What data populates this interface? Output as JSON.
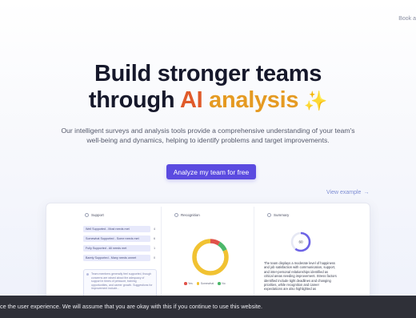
{
  "nav": {
    "link_label": "Book a"
  },
  "hero": {
    "title_line1": "Build stronger teams",
    "title_line2_prefix": "through ",
    "title_ai": "AI",
    "title_analysis": " analysis",
    "title_sparkle": " ✨"
  },
  "subtitle": "Our intelligent surveys and analysis tools provide a comprehensive understanding of your team's well-being and dynamics, helping to identify problems and target improvements.",
  "cta_label": "Analyze my team for free",
  "view_example": {
    "label": "View example",
    "arrow": "→"
  },
  "preview": {
    "support": {
      "title": "Support",
      "rows": [
        {
          "label": "Well Supported - Most needs met",
          "count": "4"
        },
        {
          "label": "Somewhat Supported - Some needs met",
          "count": "6"
        },
        {
          "label": "Fully Supported - All needs met",
          "count": "1"
        },
        {
          "label": "Barely Supported - Many needs unmet",
          "count": "0"
        }
      ],
      "note": "Team members generally feel supported, though concerns are raised about the adequacy of support in times of pressure, training opportunities, and career growth. Suggestions for improvement include..."
    },
    "recognition": {
      "title": "Recognition",
      "legend": [
        "Yes",
        "Somewhat",
        "No"
      ],
      "colors": {
        "yes": "#f1c232",
        "somewhat": "#4cb86a",
        "no": "#e0524a"
      },
      "values": {
        "yes": 82,
        "somewhat": 9,
        "no": 9
      }
    },
    "summary": {
      "title": "Summary",
      "score": "60",
      "text": "The team displays a moderate level of happiness and job satisfaction with communication, support, and inter-personal relationships identified as critical areas needing improvement. Stress factors identified include tight deadlines and changing priorities, while recognition and career expectations are also highlighted as"
    }
  },
  "cookie_text": "ce the user experience. We will assume that you are okay with this if you continue to use this website."
}
